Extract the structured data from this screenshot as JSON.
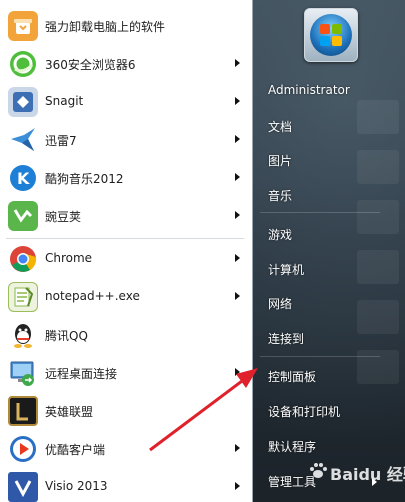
{
  "programs": [
    {
      "label": "强力卸载电脑上的软件",
      "icon": "uninstall-icon",
      "color": "#f2a33a",
      "arrow": false
    },
    {
      "label": "360安全浏览器6",
      "icon": "360-browser-icon",
      "color": "#3cae3c",
      "arrow": true
    },
    {
      "label": "Snagit",
      "icon": "snagit-icon",
      "color": "#3d6fb4",
      "arrow": true
    },
    {
      "label": "迅雷7",
      "icon": "thunder-icon",
      "color": "#3b8fd8",
      "arrow": true
    },
    {
      "label": "酷狗音乐2012",
      "icon": "kugou-icon",
      "color": "#1e7fd6",
      "arrow": true
    },
    {
      "label": "豌豆荚",
      "icon": "wandoujia-icon",
      "color": "#5ab54a",
      "arrow": true
    },
    {
      "label": "Chrome",
      "icon": "chrome-icon",
      "color": "#e0e0e0",
      "arrow": true
    },
    {
      "label": "notepad++.exe",
      "icon": "notepadpp-icon",
      "color": "#8ab84a",
      "arrow": true
    },
    {
      "label": "腾讯QQ",
      "icon": "qq-icon",
      "color": "#222222",
      "arrow": false
    },
    {
      "label": "远程桌面连接",
      "icon": "remote-desktop-icon",
      "color": "#4a8ccf",
      "arrow": true
    },
    {
      "label": "英雄联盟",
      "icon": "lol-icon",
      "color": "#6b5a2c",
      "arrow": false
    },
    {
      "label": "优酷客户端",
      "icon": "youku-icon",
      "color": "#2a6fc6",
      "arrow": true
    },
    {
      "label": "Visio 2013",
      "icon": "visio-icon",
      "color": "#3058a8",
      "arrow": true
    }
  ],
  "right_items": [
    {
      "label": "Administrator",
      "name": "user-name"
    },
    {
      "label": "文档",
      "name": "documents"
    },
    {
      "label": "图片",
      "name": "pictures"
    },
    {
      "label": "音乐",
      "name": "music"
    },
    {
      "label": "游戏",
      "name": "games"
    },
    {
      "label": "计算机",
      "name": "computer"
    },
    {
      "label": "网络",
      "name": "network"
    },
    {
      "label": "连接到",
      "name": "connect-to"
    },
    {
      "label": "控制面板",
      "name": "control-panel"
    },
    {
      "label": "设备和打印机",
      "name": "devices-printers"
    },
    {
      "label": "默认程序",
      "name": "default-programs"
    },
    {
      "label": "管理工具",
      "name": "admin-tools"
    }
  ],
  "watermark": {
    "text": "Baidu 经验"
  },
  "colors": {
    "annotation_arrow": "#e0212b",
    "list_bg": "#ffffff",
    "pane_bg": "#2c3a45"
  }
}
